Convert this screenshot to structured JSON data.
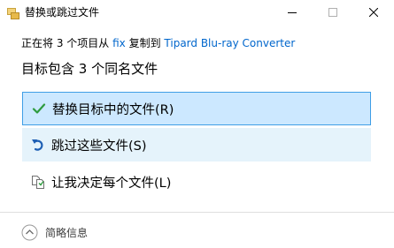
{
  "window": {
    "title": "替换或跳过文件",
    "icon": "copy-files-icon",
    "minimize_icon": "minimize-icon",
    "maximize_icon": "maximize-icon",
    "close_icon": "close-icon"
  },
  "description": {
    "prefix": "正在将 3 个项目从 ",
    "source": "fix",
    "middle": " 复制到 ",
    "destination": "Tipard Blu-ray Converter"
  },
  "heading": "目标包含 3 个同名文件",
  "options": [
    {
      "label": "替换目标中的文件(R)",
      "icon": "checkmark-icon"
    },
    {
      "label": "跳过这些文件(S)",
      "icon": "skip-arrow-icon"
    },
    {
      "label": "让我决定每个文件(L)",
      "icon": "file-compare-icon"
    }
  ],
  "details": {
    "label": "简略信息",
    "icon": "chevron-up-circle-icon"
  },
  "colors": {
    "link": "#0066cc",
    "selected_bg": "#cce8ff",
    "selected_border": "#3f9ee6",
    "hover_bg": "#e5f3fb",
    "check_green": "#2e9b3e",
    "skip_blue": "#1e5fb4"
  }
}
